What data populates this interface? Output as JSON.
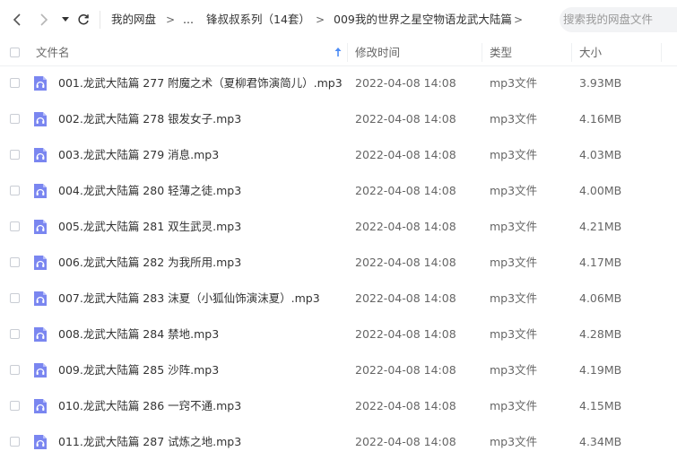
{
  "toolbar": {
    "back_icon": "chevron-left-icon",
    "forward_icon": "chevron-right-icon",
    "dropdown_icon": "caret-down-icon",
    "refresh_icon": "refresh-icon",
    "breadcrumb": {
      "root": "我的网盘",
      "sep": ">",
      "ellipsis": "...",
      "level1": "锋叔叔系列（14套）",
      "level2": "009我的世界之星空物语龙武大陆篇"
    },
    "search_placeholder": "搜索我的网盘文件"
  },
  "columns": {
    "name": "文件名",
    "modified": "修改时间",
    "type": "类型",
    "size": "大小"
  },
  "accent_color": "#4d8cf5",
  "file_icon_color": "#7a86f0",
  "files": [
    {
      "name": "001.龙武大陆篇 277 附魔之术（夏柳君饰演简儿）.mp3",
      "modified": "2022-04-08 14:08",
      "type": "mp3文件",
      "size": "3.93MB"
    },
    {
      "name": "002.龙武大陆篇 278 银发女子.mp3",
      "modified": "2022-04-08 14:08",
      "type": "mp3文件",
      "size": "4.16MB"
    },
    {
      "name": "003.龙武大陆篇 279 消息.mp3",
      "modified": "2022-04-08 14:08",
      "type": "mp3文件",
      "size": "4.03MB"
    },
    {
      "name": "004.龙武大陆篇 280 轻薄之徒.mp3",
      "modified": "2022-04-08 14:08",
      "type": "mp3文件",
      "size": "4.00MB"
    },
    {
      "name": "005.龙武大陆篇 281 双生武灵.mp3",
      "modified": "2022-04-08 14:08",
      "type": "mp3文件",
      "size": "4.21MB"
    },
    {
      "name": "006.龙武大陆篇 282 为我所用.mp3",
      "modified": "2022-04-08 14:08",
      "type": "mp3文件",
      "size": "4.17MB"
    },
    {
      "name": "007.龙武大陆篇 283 沫夏（小狐仙饰演沫夏）.mp3",
      "modified": "2022-04-08 14:08",
      "type": "mp3文件",
      "size": "4.06MB"
    },
    {
      "name": "008.龙武大陆篇 284 禁地.mp3",
      "modified": "2022-04-08 14:08",
      "type": "mp3文件",
      "size": "4.28MB"
    },
    {
      "name": "009.龙武大陆篇 285 沙阵.mp3",
      "modified": "2022-04-08 14:08",
      "type": "mp3文件",
      "size": "4.19MB"
    },
    {
      "name": "010.龙武大陆篇 286 一窍不通.mp3",
      "modified": "2022-04-08 14:08",
      "type": "mp3文件",
      "size": "4.15MB"
    },
    {
      "name": "011.龙武大陆篇 287 试炼之地.mp3",
      "modified": "2022-04-08 14:08",
      "type": "mp3文件",
      "size": "4.34MB"
    }
  ]
}
